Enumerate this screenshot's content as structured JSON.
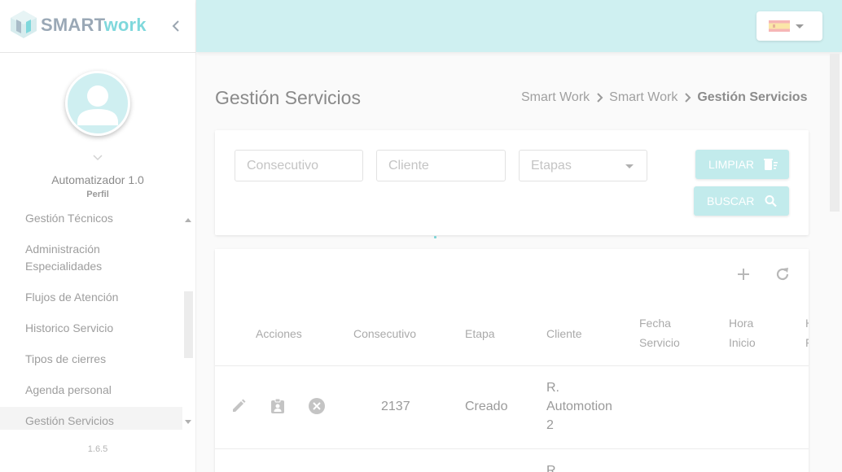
{
  "brand": {
    "name_part1": "SMART",
    "name_part2": "work",
    "colors": {
      "primary": "#cff0f1",
      "accent": "#7fd8dc",
      "button": "#c2ebec"
    }
  },
  "sidebar": {
    "collapse_icon": "chevron-left-icon",
    "user": {
      "name": "Automatizador 1.0",
      "role": "Perfil",
      "avatar_icon": "user-icon"
    },
    "menu": [
      {
        "label": "Gestión Técnicos"
      },
      {
        "label": "Administración Especialidades"
      },
      {
        "label": "Flujos de Atención"
      },
      {
        "label": "Historico Servicio"
      },
      {
        "label": "Tipos de cierres"
      },
      {
        "label": "Agenda personal"
      },
      {
        "label": "Gestión Servicios",
        "active": true
      }
    ],
    "version": "1.6.5"
  },
  "header": {
    "language": {
      "selected": "es",
      "flag_icon": "spain-flag-icon"
    }
  },
  "page": {
    "title": "Gestión Servicios",
    "breadcrumb": [
      "Smart Work",
      "Smart Work",
      "Gestión Servicios"
    ]
  },
  "filters": {
    "consecutivo_placeholder": "Consecutivo",
    "cliente_placeholder": "Cliente",
    "etapas_placeholder": "Etapas",
    "clear_label": "LIMPIAR",
    "search_label": "BUSCAR"
  },
  "table": {
    "toolbar_icons": [
      "add-icon",
      "refresh-icon"
    ],
    "columns": {
      "acciones": "Acciones",
      "consecutivo": "Consecutivo",
      "etapa": "Etapa",
      "cliente": "Cliente",
      "fecha_1": "Fecha",
      "fecha_2": "Servicio",
      "hora_1": "Hora",
      "hora_2": "Inicio"
    },
    "rows": [
      {
        "consecutivo": "2137",
        "etapa": "Creado",
        "cliente_lines": [
          "R.",
          "Automotion",
          "2"
        ],
        "action_icons": [
          "edit-icon",
          "assignment-icon",
          "cancel-icon"
        ]
      },
      {
        "cliente_lines": [
          "R."
        ]
      }
    ]
  }
}
